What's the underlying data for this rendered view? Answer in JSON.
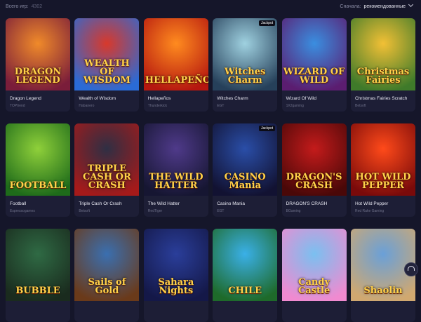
{
  "header": {
    "total_label": "Всего игр:",
    "total_count": "4302",
    "sort_label": "Сначала:",
    "sort_value": "рекомендованные"
  },
  "games": [
    {
      "name": "Dragon Legend",
      "provider": "TOPtrend",
      "art": "DRAGON LEGEND",
      "colors": [
        "#f08a2a",
        "#7a1d3a"
      ]
    },
    {
      "name": "Wealth of Wisdom",
      "provider": "Habanero",
      "art": "WEALTH OF WISDOM",
      "colors": [
        "#d8392b",
        "#2a6bd6"
      ]
    },
    {
      "name": "Hellapeños",
      "provider": "Thunderkick",
      "art": "HELLAPEÑOS",
      "colors": [
        "#ff8b1f",
        "#b5170f"
      ]
    },
    {
      "name": "Witches Charm",
      "provider": "EGT",
      "art": "Witches Charm",
      "colors": [
        "#9fd1e0",
        "#26405a"
      ],
      "badge": "Jackpot"
    },
    {
      "name": "Wizard Of Wild",
      "provider": "1X2gaming",
      "art": "WIZARD OF WILD",
      "colors": [
        "#3a8ee0",
        "#5b1d70"
      ]
    },
    {
      "name": "Christmas Fairies Scratch",
      "provider": "Betsoft",
      "art": "Christmas Fairies",
      "colors": [
        "#f2c035",
        "#3f7a2a"
      ]
    },
    {
      "name": "Football",
      "provider": "Espressogames",
      "art": "FOOTBALL",
      "colors": [
        "#8fd03a",
        "#1e6b1a"
      ]
    },
    {
      "name": "Triple Cash Or Crash",
      "provider": "Betsoft",
      "art": "TRIPLE CASH OR CRASH",
      "colors": [
        "#2f2f44",
        "#a51a1a"
      ]
    },
    {
      "name": "The Wild Hatter",
      "provider": "RedTiger",
      "art": "THE WILD HATTER",
      "colors": [
        "#4f3a8a",
        "#161632"
      ]
    },
    {
      "name": "Casino Mania",
      "provider": "EGT",
      "art": "CASINO Mania",
      "colors": [
        "#2a4ea8",
        "#121232"
      ],
      "badge": "Jackpot"
    },
    {
      "name": "DRAGON'S CRASH",
      "provider": "BGaming",
      "art": "DRAGON'S CRASH",
      "colors": [
        "#c41b1b",
        "#4a0808"
      ]
    },
    {
      "name": "Hot Wild Pepper",
      "provider": "Red Rake Gaming",
      "art": "HOT WILD PEPPER",
      "colors": [
        "#ff4a1a",
        "#7a0a0a"
      ]
    },
    {
      "name": "",
      "provider": "",
      "art": "BUBBLE",
      "colors": [
        "#2f6a44",
        "#1a2b1e"
      ]
    },
    {
      "name": "",
      "provider": "",
      "art": "Sails of Gold",
      "colors": [
        "#3a6fb0",
        "#6a3a1a"
      ]
    },
    {
      "name": "",
      "provider": "",
      "art": "Sahara Nights",
      "colors": [
        "#2a3e9a",
        "#141848"
      ]
    },
    {
      "name": "",
      "provider": "",
      "art": "CHILE",
      "colors": [
        "#3ab0e8",
        "#1e6a2a"
      ]
    },
    {
      "name": "",
      "provider": "",
      "art": "Candy Castle",
      "colors": [
        "#7ac0f0",
        "#f08ad0"
      ]
    },
    {
      "name": "",
      "provider": "",
      "art": "Shaolin",
      "colors": [
        "#6aa0d8",
        "#d0a870"
      ]
    }
  ]
}
